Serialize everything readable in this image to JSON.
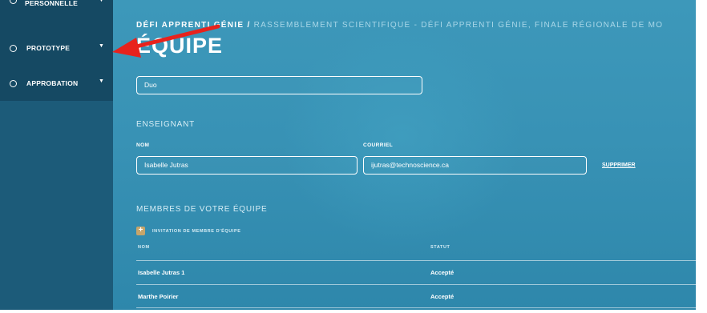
{
  "sidebar": {
    "items": [
      {
        "label": "PERSONNELLE"
      },
      {
        "label": "PROTOTYPE"
      },
      {
        "label": "APPROBATION"
      }
    ],
    "caret": "▼"
  },
  "breadcrumb": {
    "current": "DÉFI APPRENTI GÉNIE",
    "separator": "/",
    "path": "RASSEMBLEMENT SCIENTIFIQUE - DÉFI APPRENTI GÉNIE, FINALE RÉGIONALE DE MO"
  },
  "page_title": "ÉQUIPE",
  "team_name_value": "Duo",
  "teacher": {
    "heading": "ENSEIGNANT",
    "name_label": "NOM",
    "name_value": "Isabelle Jutras",
    "email_label": "COURRIEL",
    "email_value": "ijutras@technoscience.ca",
    "delete_label": "SUPPRIMER"
  },
  "members": {
    "heading": "MEMBRES DE VOTRE ÉQUIPE",
    "invite_icon": "+",
    "invite_label": "INVITATION DE MEMBRE D'ÉQUIPE",
    "columns": [
      "NOM",
      "STATUT"
    ],
    "rows": [
      {
        "name": "Isabelle Jutras 1",
        "status": "Accepté"
      },
      {
        "name": "Marthe Poirier",
        "status": "Accepté"
      }
    ]
  },
  "colors": {
    "sidebar_bg": "#1c5b79",
    "main_bg": "#3892b5",
    "accent_gold": "#c7a56a",
    "annotation_arrow": "#e8221c"
  }
}
